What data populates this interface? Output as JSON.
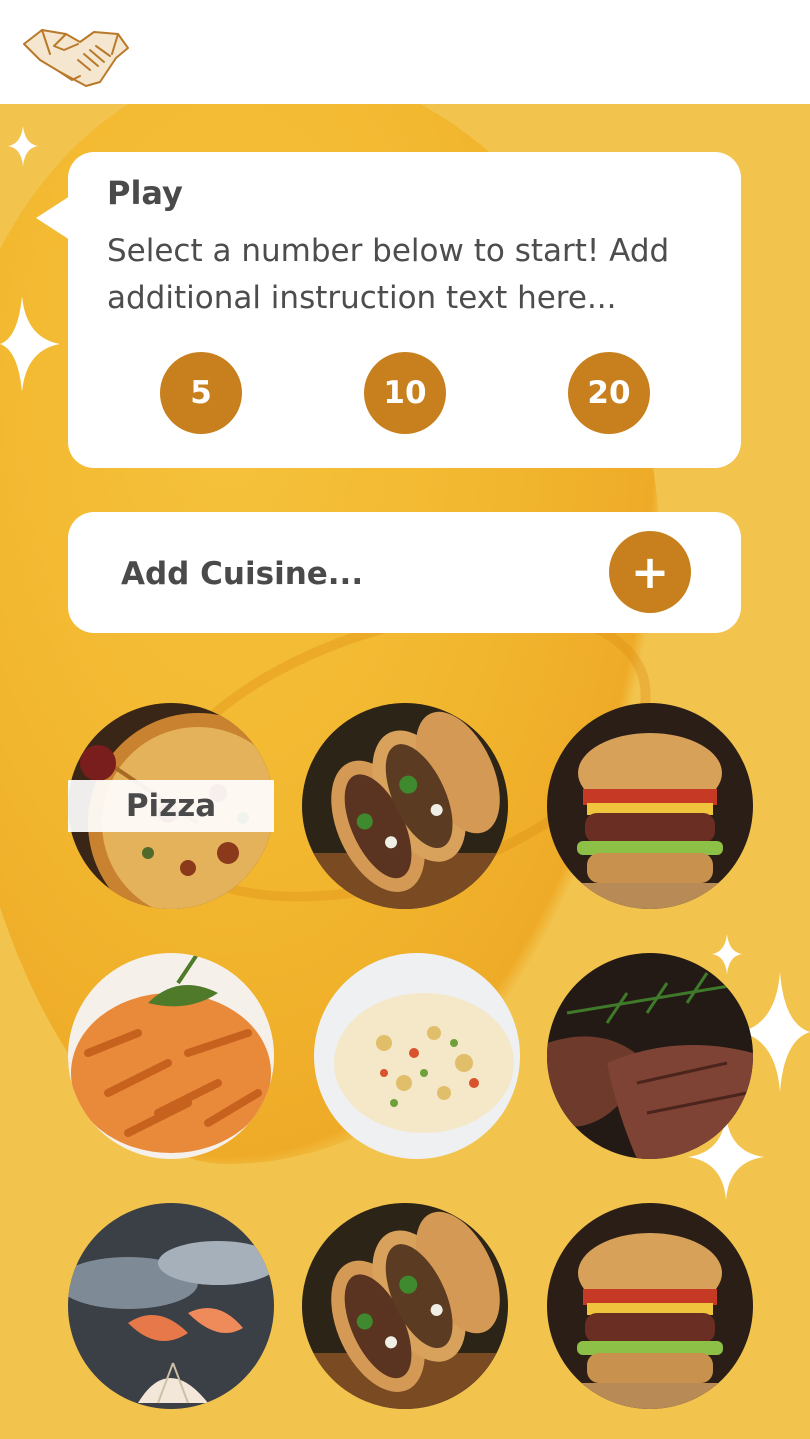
{
  "header": {
    "logo_icon": "handshake-icon"
  },
  "play_card": {
    "title": "Play",
    "instruction": "Select a number below to start! Add additional instruction text here...",
    "numbers": [
      "5",
      "10",
      "20"
    ]
  },
  "add_cuisine": {
    "label": "Add Cuisine...",
    "button_icon": "plus-icon",
    "button_label": "+"
  },
  "cuisines": [
    {
      "name": "pizza",
      "label": "Pizza"
    },
    {
      "name": "tacos"
    },
    {
      "name": "burger"
    },
    {
      "name": "pasta"
    },
    {
      "name": "fried-rice"
    },
    {
      "name": "steak"
    },
    {
      "name": "seafood"
    },
    {
      "name": "tacos"
    },
    {
      "name": "burger"
    }
  ],
  "colors": {
    "background": "#f2c44e",
    "accent": "#c8801e",
    "card": "#ffffff",
    "text": "#4a4a4a"
  }
}
